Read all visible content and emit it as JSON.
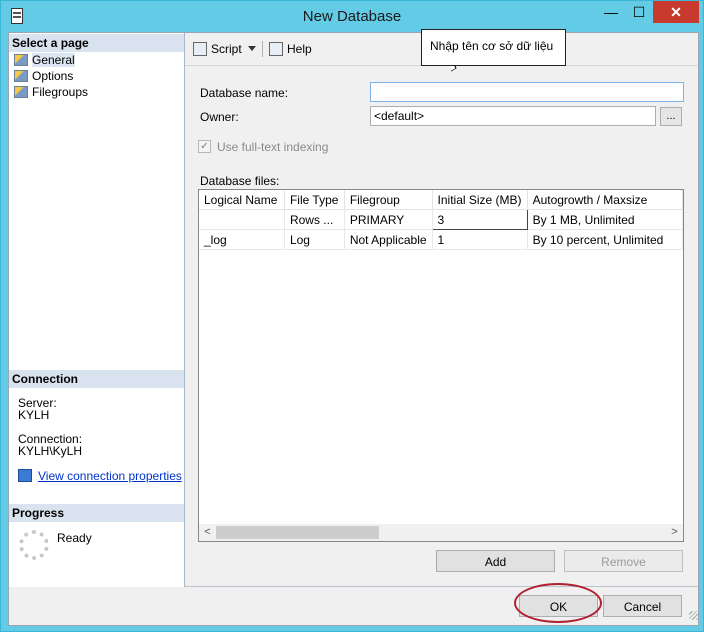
{
  "window": {
    "title": "New Database",
    "minimize_glyph": "—",
    "maximize_glyph": "☐",
    "close_glyph": "✕"
  },
  "left_pane": {
    "select_page_header": "Select a page",
    "pages": [
      {
        "label": "General",
        "selected": true
      },
      {
        "label": "Options",
        "selected": false
      },
      {
        "label": "Filegroups",
        "selected": false
      }
    ],
    "connection_header": "Connection",
    "server_label": "Server:",
    "server_value": "KYLH",
    "connection_label": "Connection:",
    "connection_value": "KYLH\\KyLH",
    "view_connection_link": "View connection properties",
    "progress_header": "Progress",
    "progress_status": "Ready"
  },
  "toolbar": {
    "script_label": "Script",
    "help_label": "Help"
  },
  "form": {
    "database_name_label": "Database name:",
    "database_name_value": "",
    "owner_label": "Owner:",
    "owner_value": "<default>",
    "browse_label": "...",
    "fulltext_label": "Use full-text indexing",
    "fulltext_checked": true,
    "database_files_label": "Database files:"
  },
  "files_grid": {
    "columns": [
      "Logical Name",
      "File Type",
      "Filegroup",
      "Initial Size (MB)",
      "Autogrowth / Maxsize"
    ],
    "rows": [
      {
        "logical_name": "",
        "file_type": "Rows ...",
        "filegroup": "PRIMARY",
        "initial_size": "3",
        "autogrowth": "By 1 MB, Unlimited"
      },
      {
        "logical_name": "_log",
        "file_type": "Log",
        "filegroup": "Not Applicable",
        "initial_size": "1",
        "autogrowth": "By 10 percent, Unlimited"
      }
    ],
    "scroll_left": "<",
    "scroll_right": ">"
  },
  "buttons": {
    "add": "Add",
    "remove": "Remove",
    "ok": "OK",
    "cancel": "Cancel"
  },
  "annotation": {
    "callout_text": "Nhập tên cơ sở dữ liệu"
  },
  "colors": {
    "frame": "#63cbe5",
    "close_button": "#c73a2d",
    "section_header": "#d8e3ef",
    "highlight_ring": "#b02030",
    "link": "#0033cc"
  }
}
